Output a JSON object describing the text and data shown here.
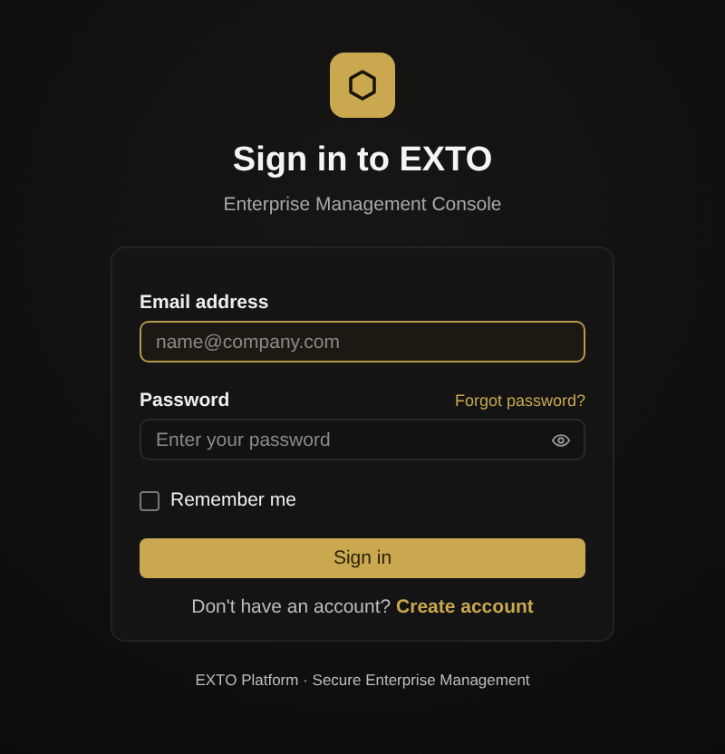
{
  "header": {
    "title": "Sign in to EXTO",
    "subtitle": "Enterprise Management Console"
  },
  "form": {
    "fields": [
      {
        "label": "Email address",
        "placeholder": "name@company.com",
        "focused": true,
        "kind": "text"
      },
      {
        "label": "Password",
        "placeholder": "Enter your password",
        "focused": false,
        "kind": "password",
        "link": "Forgot password?"
      }
    ],
    "remember": {
      "label": "Remember me",
      "checked": false
    },
    "submit": "Sign in",
    "signup": {
      "text": "Don't have an account?",
      "link": "Create account"
    }
  },
  "footer": "EXTO Platform · Secure Enterprise Management"
}
